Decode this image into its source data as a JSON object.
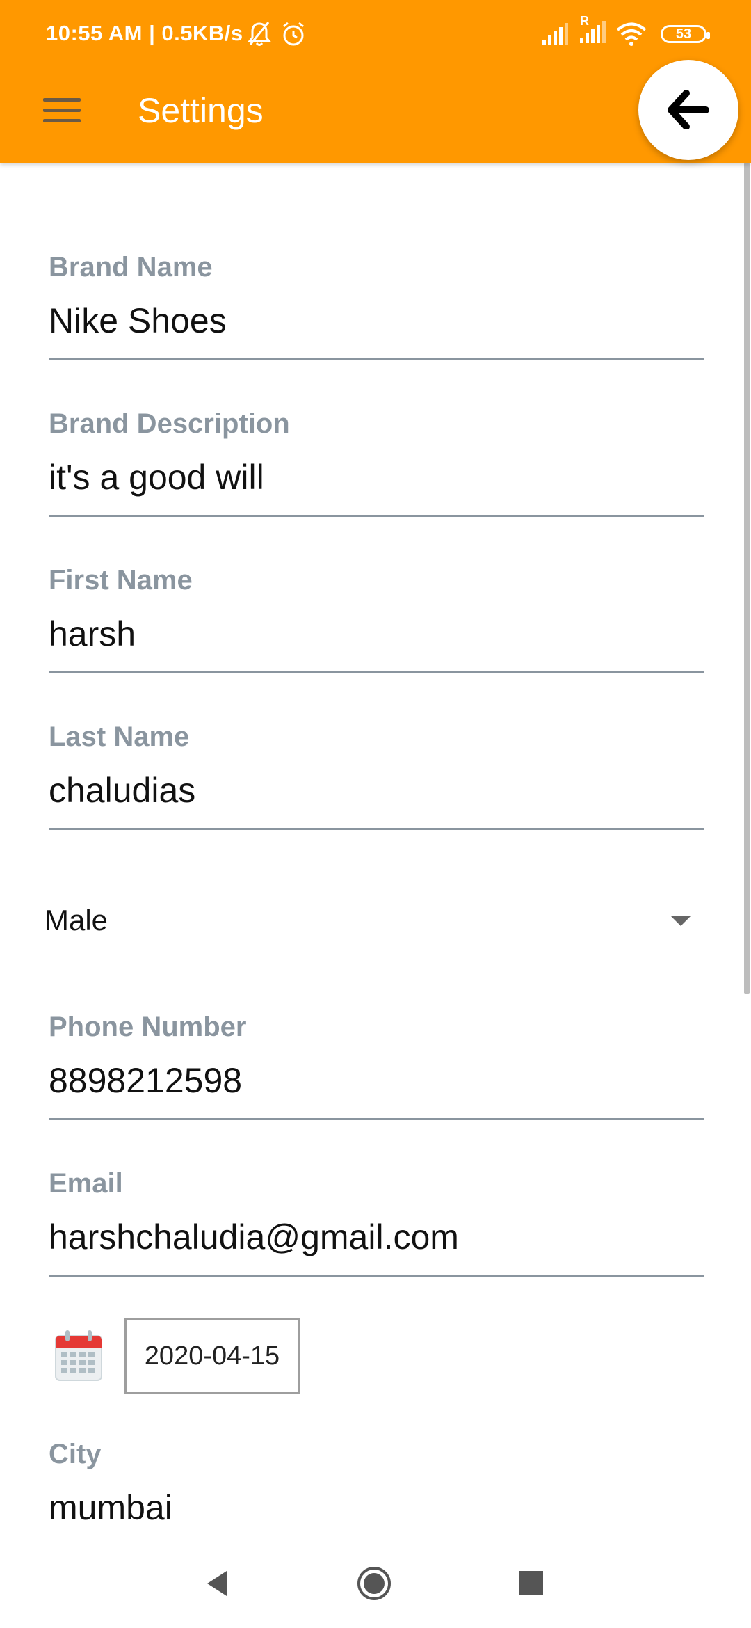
{
  "status_bar": {
    "time_speed": "10:55 AM | 0.5KB/s",
    "battery": "53",
    "roaming": "R"
  },
  "app_bar": {
    "title": "Settings"
  },
  "form": {
    "brand_name": {
      "label": "Brand Name",
      "value": "Nike Shoes"
    },
    "brand_description": {
      "label": "Brand Description",
      "value": "it's a good will"
    },
    "first_name": {
      "label": "First Name",
      "value": "harsh"
    },
    "last_name": {
      "label": "Last Name",
      "value": "chaludias"
    },
    "gender": {
      "value": "Male"
    },
    "phone": {
      "label": "Phone Number",
      "value": "8898212598"
    },
    "email": {
      "label": "Email",
      "value": "harshchaludia@gmail.com"
    },
    "date": {
      "value": "2020-04-15"
    },
    "city": {
      "label": "City",
      "value": "mumbai"
    }
  },
  "colors": {
    "app_bar": "#FF9800",
    "label": "#8a959f",
    "calendar_red": "#e53935"
  },
  "icons": {
    "menu": "hamburger-menu-icon",
    "back": "arrow-left-icon",
    "calendar": "calendar-icon",
    "nav_back": "triangle-back-icon",
    "nav_home": "circle-home-icon",
    "nav_recent": "square-recents-icon"
  }
}
